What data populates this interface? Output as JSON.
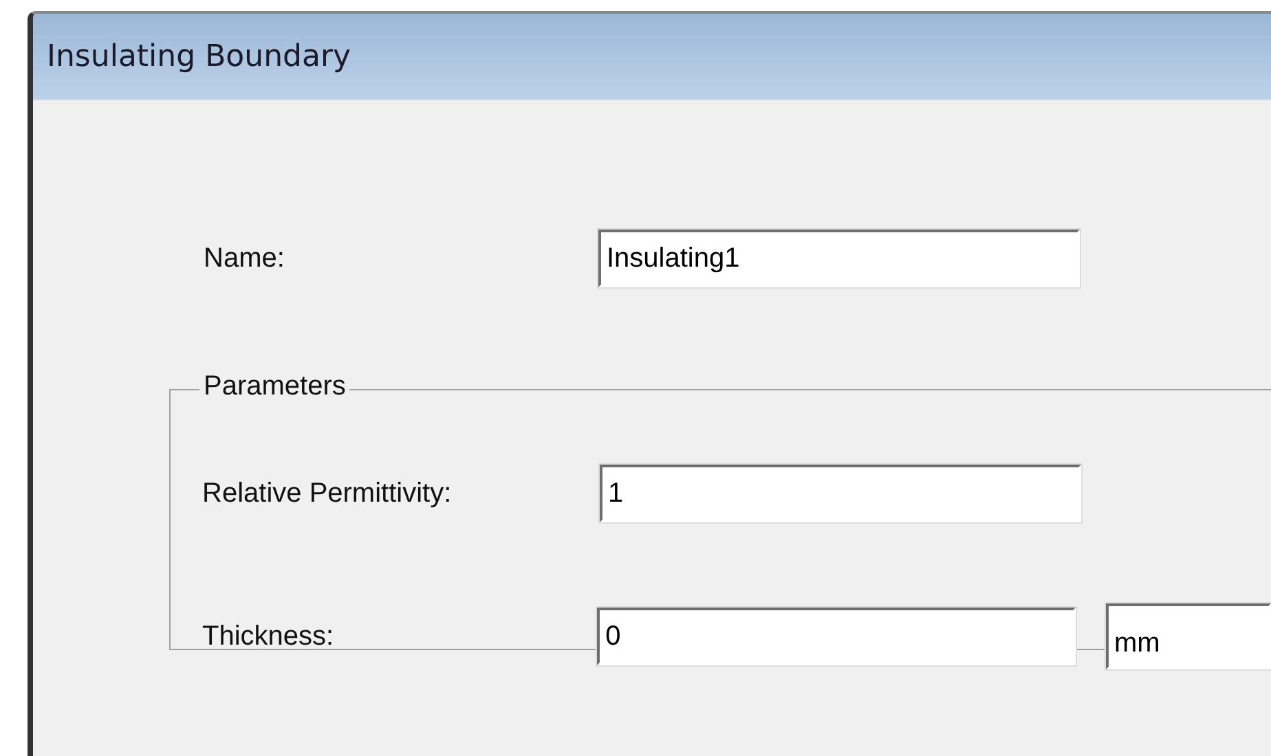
{
  "window": {
    "title": "Insulating Boundary"
  },
  "name_field": {
    "label": "Name:",
    "value": "Insulating1"
  },
  "parameters": {
    "title": "Parameters",
    "fields": [
      {
        "label": "Relative Permittivity:",
        "value": "1"
      },
      {
        "label": "Thickness:",
        "value": "0",
        "unit": "mm"
      }
    ]
  }
}
